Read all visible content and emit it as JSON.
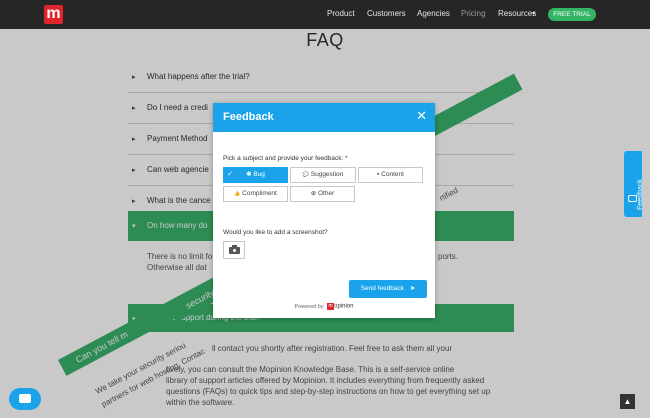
{
  "nav": {
    "logo": "m",
    "links": [
      "Product",
      "Customers",
      "Agencies",
      "Pricing",
      "Resources"
    ],
    "resources_caret": "▾",
    "cta": "FREE TRIAL"
  },
  "page": {
    "title": "FAQ",
    "questions": [
      "What happens after the trial?",
      "Do I need a credi",
      "Payment Method",
      "Can web agencie",
      "What is the cance",
      "On how many do",
      "Do I get support during the trial?"
    ],
    "answer_1": [
      "There is no limit fo",
      "Otherwise all dat"
    ],
    "answer_1_right": "ports.",
    "answer_2_line1": "ll contact you shortly after registration. Feel free to ask them all your",
    "answer_2_lines": [
      "tively, you can consult the Mopinion Knowledge Base. This is a self-service online",
      "library of support articles offered by Mopinion. It includes everything from frequently asked",
      "questions (FAQs) to quick tips and step-by-step instructions on how to get everything set up",
      "within the software."
    ],
    "ribbon_security": "security?",
    "ribbon_tell": "Can you tell m",
    "rot_line_1": "We take your security seriou",
    "rot_line_2": "partners for web hosting. Contac",
    "certified": "rtified"
  },
  "modal": {
    "title": "Feedback",
    "close": "✕",
    "prompt": "Pick a subject and provide your feedback: *",
    "options": [
      "Bug",
      "Suggestion",
      "Content",
      "Compliment",
      "Other"
    ],
    "option_icons": [
      "✓",
      "💬",
      "▪",
      "👍",
      "⊕"
    ],
    "screenshot_prompt": "Would you like to add a screenshot?",
    "send": "Send feedback",
    "send_icon": "➤",
    "powered_by": "Powered by",
    "brand_logo": "m",
    "brand": "opinion"
  },
  "side_tab": {
    "label": "Feedback"
  },
  "scroll_top": "▲"
}
